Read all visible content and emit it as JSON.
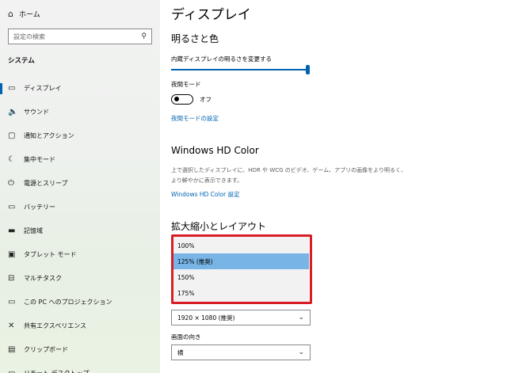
{
  "sidebar": {
    "home_icon": "home-icon",
    "home_label": "ホーム",
    "search_placeholder": "設定の検索",
    "search_icon": "search-icon",
    "section_title": "システム",
    "items": [
      {
        "label": "ディスプレイ",
        "icon": "monitor-icon",
        "glyph": "▭",
        "active": true
      },
      {
        "label": "サウンド",
        "icon": "speaker-icon",
        "glyph": "🔈",
        "active": false
      },
      {
        "label": "通知とアクション",
        "icon": "notification-icon",
        "glyph": "▢",
        "active": false
      },
      {
        "label": "集中モード",
        "icon": "moon-icon",
        "glyph": "☾",
        "active": false
      },
      {
        "label": "電源とスリープ",
        "icon": "power-icon",
        "glyph": "⏻",
        "active": false
      },
      {
        "label": "バッテリー",
        "icon": "battery-icon",
        "glyph": "▭",
        "active": false
      },
      {
        "label": "記憶域",
        "icon": "storage-icon",
        "glyph": "▬",
        "active": false
      },
      {
        "label": "タブレット モード",
        "icon": "tablet-icon",
        "glyph": "▣",
        "active": false
      },
      {
        "label": "マルチタスク",
        "icon": "multitask-icon",
        "glyph": "⊟",
        "active": false
      },
      {
        "label": "この PC へのプロジェクション",
        "icon": "projection-icon",
        "glyph": "▭",
        "active": false
      },
      {
        "label": "共有エクスペリエンス",
        "icon": "shared-icon",
        "glyph": "✕",
        "active": false
      },
      {
        "label": "クリップボード",
        "icon": "clipboard-icon",
        "glyph": "▤",
        "active": false
      },
      {
        "label": "リモート デスクトップ",
        "icon": "remote-icon",
        "glyph": "▭",
        "active": false
      }
    ]
  },
  "main": {
    "title": "ディスプレイ",
    "brightness": {
      "heading": "明るさと色",
      "slider_label": "内蔵ディスプレイの明るさを変更する",
      "value_percent": 100
    },
    "night_light": {
      "label": "夜間モード",
      "state": "オフ",
      "settings_link": "夜間モードの設定"
    },
    "hd_color": {
      "heading": "Windows HD Color",
      "description": "上で選択したディスプレイに、HDR や WCG のビデオ、ゲーム、アプリの画像をより明るく、より鮮やかに表示できます。",
      "settings_link": "Windows HD Color 設定"
    },
    "scale_layout": {
      "heading": "拡大縮小とレイアウト",
      "options": [
        "100%",
        "125% (推奨)",
        "150%",
        "175%"
      ],
      "selected_index": 1,
      "resolution_value": "1920 × 1080 (推奨)",
      "orientation_label": "画面の向き",
      "orientation_value": "横"
    }
  },
  "colors": {
    "accent": "#0063b1",
    "selected_option": "#78b4e6",
    "highlight_border": "#d81e24"
  }
}
